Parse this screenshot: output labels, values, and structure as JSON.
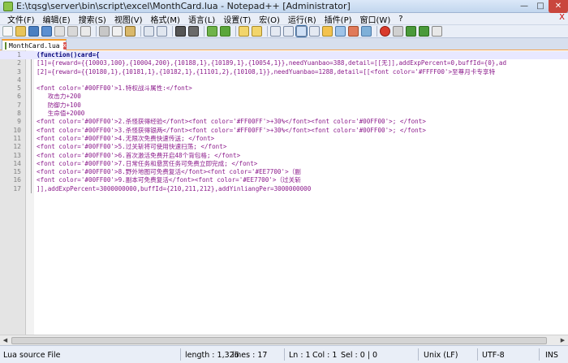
{
  "window": {
    "title": "E:\\tqsg\\server\\bin\\script\\excel\\MonthCard.lua - Notepad++ [Administrator]",
    "min_glyph": "—",
    "max_glyph": "□",
    "close_glyph": "✕"
  },
  "menu": [
    "文件(F)",
    "编辑(E)",
    "搜索(S)",
    "视图(V)",
    "格式(M)",
    "语言(L)",
    "设置(T)",
    "宏(O)",
    "运行(R)",
    "插件(P)",
    "窗口(W)",
    "?"
  ],
  "menu_close": "X",
  "tab": {
    "label": "MonthCard.lua",
    "close_glyph": "x"
  },
  "editor": {
    "lines": [
      {
        "n": "1",
        "text": "(function()card={"
      },
      {
        "n": "2",
        "text": "[1]={reward={{10003,100},{10004,200},{10188,1},{10189,1},{10054,1}},needYuanbao=388,detail=[[无]],addExpPercent=0,buffId={0},ad"
      },
      {
        "n": "3",
        "text": "[2]={reward={{10180,1},{10181,1},{10182,1},{11101,2},{10108,1}},needYuanbao=1288,detail=[[<font color='#FFFF00'>至尊月卡专享特"
      },
      {
        "n": "4",
        "text": ""
      },
      {
        "n": "5",
        "text": "<font color='#00FF00'>1.特权战斗属性:</font>"
      },
      {
        "n": "6",
        "text": "   攻击力+200"
      },
      {
        "n": "7",
        "text": "   防御力+100"
      },
      {
        "n": "8",
        "text": "   生命值+2000"
      },
      {
        "n": "9",
        "text": "<font color='#00FF00'>2.杀怪获得经验</font><font color='#FF00FF'>+30%</font><font color='#00FF00'>; </font>"
      },
      {
        "n": "10",
        "text": "<font color='#00FF00'>3.杀怪获得银两</font><font color='#FF00FF'>+30%</font><font color='#00FF00'>; </font>"
      },
      {
        "n": "11",
        "text": "<font color='#00FF00'>4.无限次免费快速传送; </font>"
      },
      {
        "n": "12",
        "text": "<font color='#00FF00'>5.过关斩将可使用快速扫荡; </font>"
      },
      {
        "n": "13",
        "text": "<font color='#00FF00'>6.首次激活免费开启48个背包格; </font>"
      },
      {
        "n": "14",
        "text": "<font color='#00FF00'>7.日常任务和悬赏任务可免费立即完成; </font>"
      },
      {
        "n": "15",
        "text": "<font color='#00FF00'>8.野外地图可免费复活</font><font color='#EE7700'>（副"
      },
      {
        "n": "16",
        "text": "<font color='#00FF00'>9.副本可免费复活</font><font color='#EE7700'>（过关斩"
      },
      {
        "n": "17",
        "text": "]],addExpPercent=3000000000,buffId={210,211,212},addYinliangPer=3000000000"
      }
    ]
  },
  "status": {
    "file_type": "Lua source File",
    "length": "length : 1,326",
    "lines": "lines : 17",
    "ln": "Ln : 1",
    "col": "Col : 1",
    "sel": "Sel : 0 | 0",
    "eol": "Unix (LF)",
    "encoding": "UTF-8",
    "mode": "INS"
  }
}
